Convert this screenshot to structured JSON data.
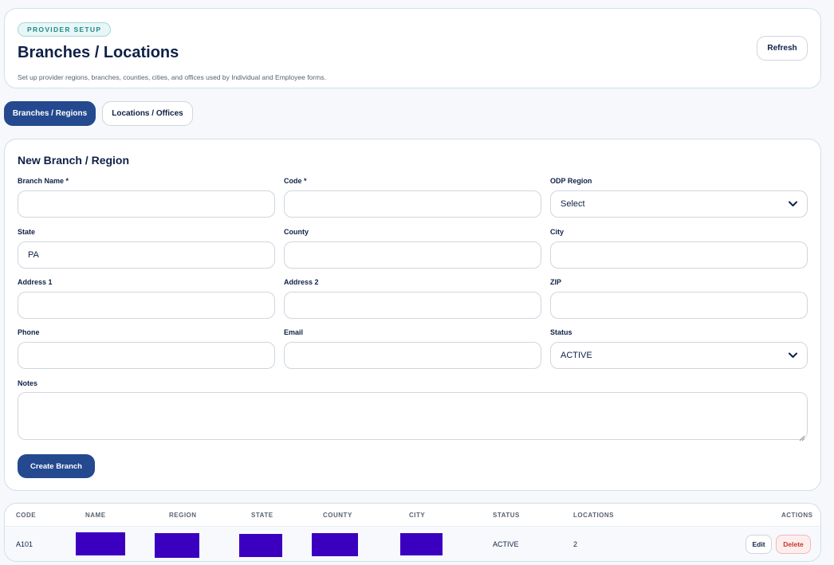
{
  "header": {
    "eyebrow": "PROVIDER SETUP",
    "title": "Branches / Locations",
    "subtitle": "Set up provider regions, branches, counties, cities, and offices used by Individual and Employee forms.",
    "refresh_label": "Refresh"
  },
  "tabs": [
    {
      "label": "Branches / Regions",
      "active": true
    },
    {
      "label": "Locations / Offices",
      "active": false
    }
  ],
  "form": {
    "title": "New Branch / Region",
    "fields": {
      "branch_name": {
        "label": "Branch Name *",
        "value": ""
      },
      "code": {
        "label": "Code *",
        "value": ""
      },
      "odp_region": {
        "label": "ODP Region",
        "value": "Select"
      },
      "state": {
        "label": "State",
        "value": "PA"
      },
      "county": {
        "label": "County",
        "value": ""
      },
      "city": {
        "label": "City",
        "value": ""
      },
      "address1": {
        "label": "Address 1",
        "value": ""
      },
      "address2": {
        "label": "Address 2",
        "value": ""
      },
      "zip": {
        "label": "ZIP",
        "value": ""
      },
      "phone": {
        "label": "Phone",
        "value": ""
      },
      "email": {
        "label": "Email",
        "value": ""
      },
      "status": {
        "label": "Status",
        "value": "ACTIVE"
      },
      "notes": {
        "label": "Notes",
        "value": ""
      }
    },
    "submit_label": "Create Branch"
  },
  "table": {
    "columns": [
      "CODE",
      "NAME",
      "REGION",
      "STATE",
      "COUNTY",
      "CITY",
      "STATUS",
      "LOCATIONS",
      "ACTIONS"
    ],
    "rows": [
      {
        "code": "A101",
        "status": "ACTIVE",
        "locations": "2",
        "edit_label": "Edit",
        "delete_label": "Delete"
      }
    ]
  },
  "colors": {
    "primary": "#24498f",
    "accent_teal": "#1f8a8a",
    "redaction": "#3b00bf",
    "danger": "#c0392b"
  }
}
